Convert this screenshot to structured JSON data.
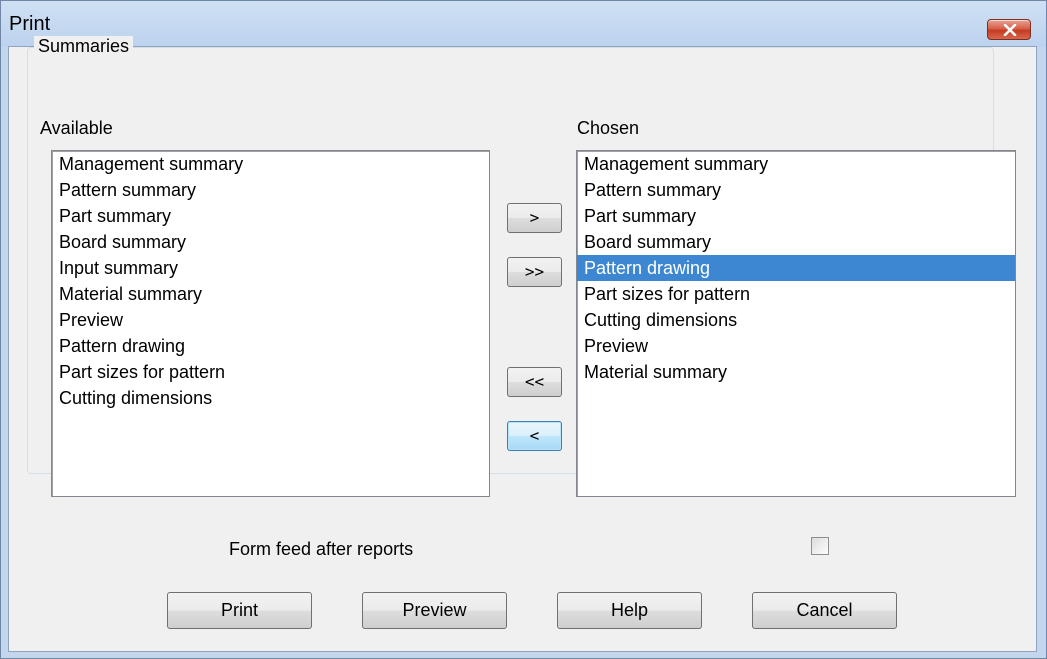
{
  "window": {
    "title": "Print"
  },
  "summaries": {
    "group_label": "Summaries",
    "available_label": "Available",
    "chosen_label": "Chosen",
    "available_items": [
      "Management summary",
      "Pattern summary",
      "Part summary",
      "Board summary",
      "Input summary",
      "Material summary",
      "Preview",
      "Pattern drawing",
      "Part sizes for pattern",
      "Cutting dimensions"
    ],
    "chosen_items": [
      "Management summary",
      "Pattern summary",
      "Part summary",
      "Board summary",
      "Pattern drawing",
      "Part sizes for pattern",
      "Cutting dimensions",
      "Preview",
      "Material summary"
    ],
    "chosen_selected": "Pattern drawing"
  },
  "transfer": {
    "add_one": ">",
    "add_all": ">>",
    "remove_all": "<<",
    "remove_one": "<"
  },
  "options": {
    "form_feed_label": "Form feed after reports",
    "form_feed_checked": false
  },
  "buttons": {
    "print": "Print",
    "preview": "Preview",
    "help": "Help",
    "cancel": "Cancel"
  },
  "colors": {
    "selection": "#3d86d1",
    "close_button": "#c43b22"
  },
  "icons": {
    "close": "close-icon"
  }
}
